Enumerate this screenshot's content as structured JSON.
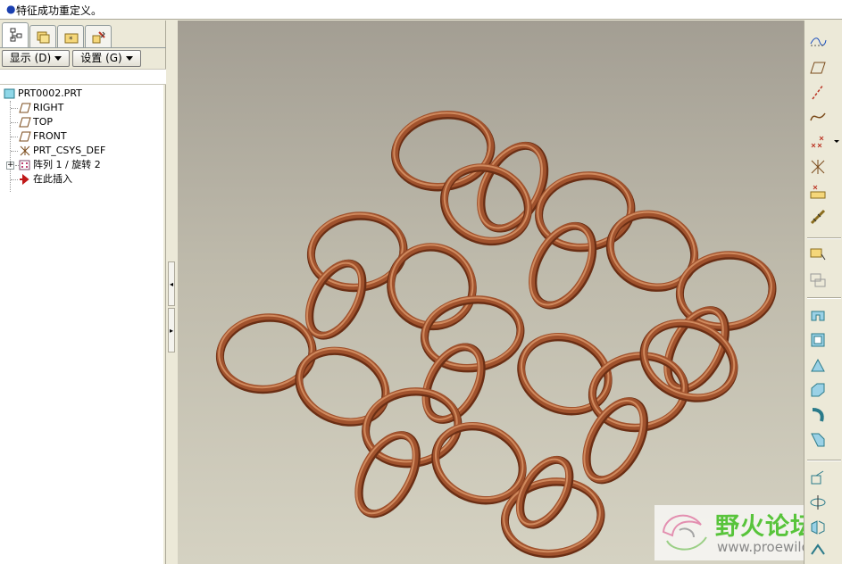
{
  "message": {
    "text": "特征成功重定义。"
  },
  "toolbar": {
    "show_label": "显示 (D)",
    "settings_label": "设置 (G)"
  },
  "tree": {
    "root": "PRT0002.PRT",
    "items": [
      {
        "label": "RIGHT",
        "icon": "datum-plane-icon"
      },
      {
        "label": "TOP",
        "icon": "datum-plane-icon"
      },
      {
        "label": "FRONT",
        "icon": "datum-plane-icon"
      },
      {
        "label": "PRT_CSYS_DEF",
        "icon": "coordinate-system-icon"
      },
      {
        "label": "阵列 1 / 旋转 2",
        "icon": "pattern-icon"
      },
      {
        "label": "在此插入",
        "icon": "insert-here-icon"
      }
    ]
  },
  "colors": {
    "chain": "#a0522d",
    "chain_highlight": "#d08a5e",
    "chain_shadow": "#6a2e14",
    "watermark_green": "#58c43b"
  },
  "watermark": {
    "name": "野火论坛",
    "url": "www.proewildfire.cn"
  }
}
